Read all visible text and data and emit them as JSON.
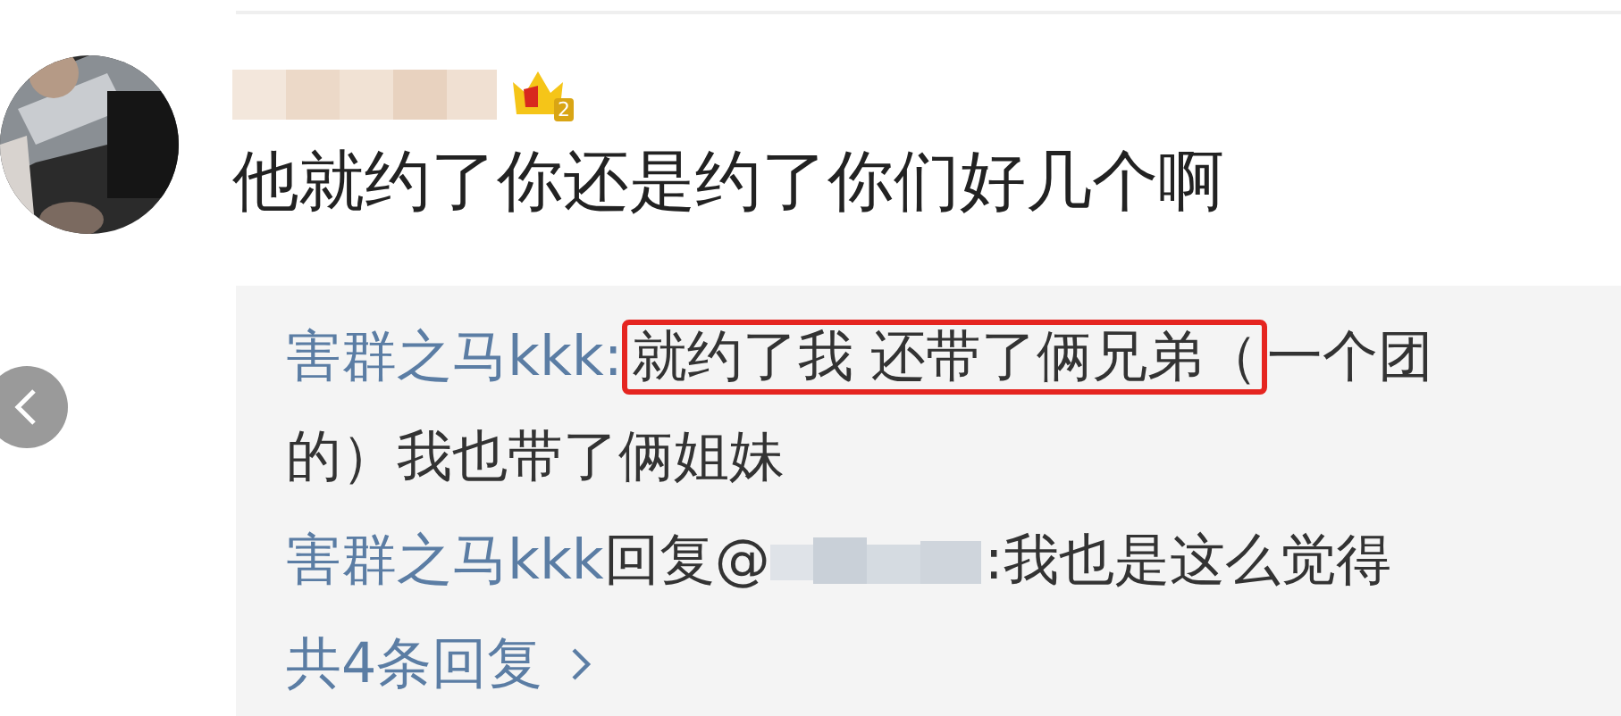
{
  "comment": {
    "badge": {
      "level": "2"
    },
    "text": "他就约了你还是约了你们好几个啊"
  },
  "replies": [
    {
      "kind": "highlighted",
      "author": "害群之马kkk:",
      "highlight": "就约了我 还带了俩兄弟（",
      "rest": "一个团的）我也带了俩姐妹"
    },
    {
      "kind": "reply_to",
      "author": "害群之马kkk",
      "reply_word": "回复@",
      "text": ":我也是这么觉得"
    }
  ],
  "more_replies": "共4条回复"
}
